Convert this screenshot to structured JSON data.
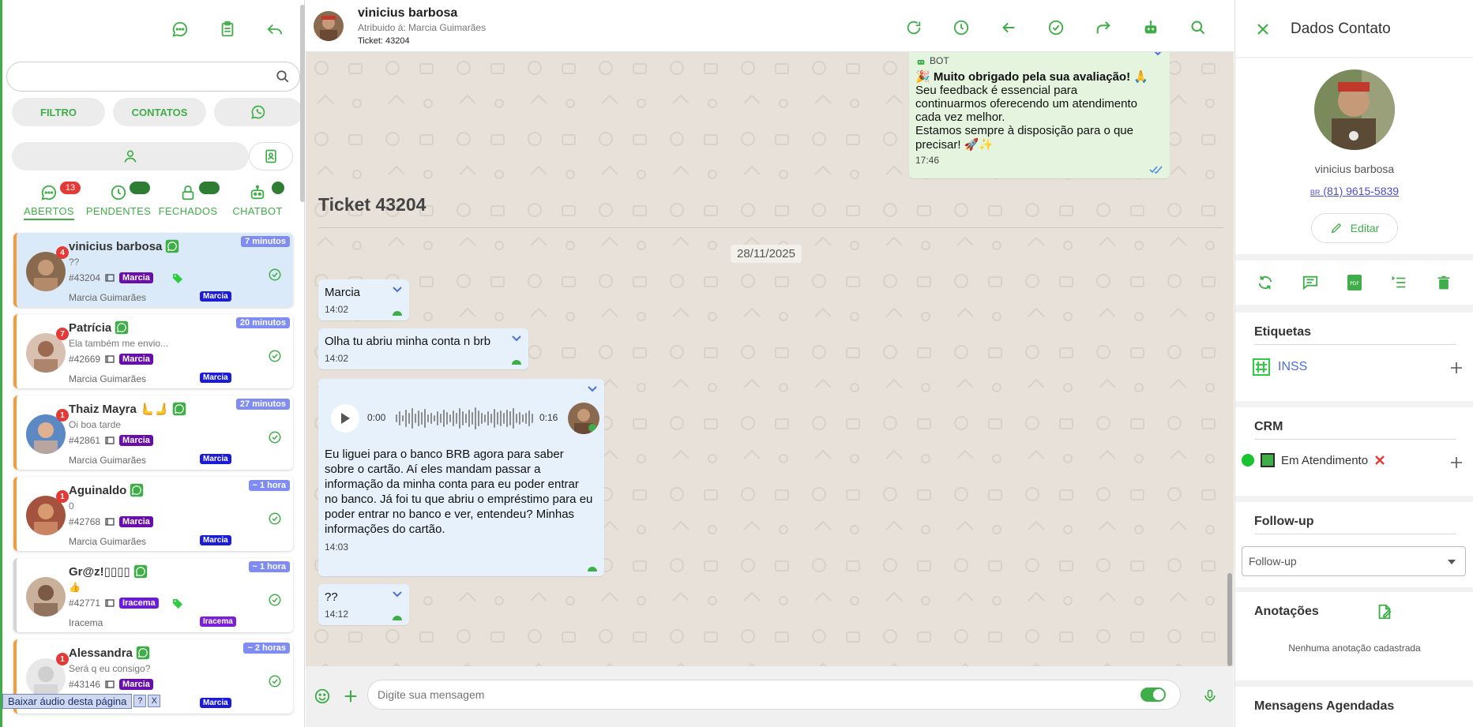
{
  "left": {
    "search": {
      "placeholder": "",
      "value": ""
    },
    "filters": [
      {
        "label": "FILTRO"
      },
      {
        "label": "CONTATOS"
      }
    ],
    "tabs": [
      {
        "label": "ABERTOS",
        "badge": "13",
        "icon": "chat-bubble-icon",
        "active": true
      },
      {
        "label": "PENDENTES",
        "badge": "0",
        "icon": "clock-icon"
      },
      {
        "label": "FECHADOS",
        "badge": "0",
        "icon": "lock-icon"
      },
      {
        "label": "CHATBOT",
        "badge": "0",
        "icon": "robot-icon"
      }
    ],
    "tickets": [
      {
        "name": "vinicius barbosa",
        "badge": "4",
        "message": "??",
        "id": "#43204",
        "tag": "Marcia",
        "user": "Marcia Guimarães",
        "user_tag": "Marcia",
        "time": "7 minutos",
        "selected": true,
        "label_icon": true
      },
      {
        "name": "Patrícia",
        "badge": "7",
        "message": "Ela também me envio...",
        "id": "#42669",
        "tag": "Marcia",
        "user": "Marcia Guimarães",
        "user_tag": "Marcia",
        "time": "20 minutos"
      },
      {
        "name": "Thaiz Mayra",
        "emoji": "🫷🫸",
        "badge": "1",
        "message": "Oi boa tarde",
        "id": "#42861",
        "tag": "Marcia",
        "user": "Marcia Guimarães",
        "user_tag": "Marcia",
        "time": "27 minutos"
      },
      {
        "name": "Aguinaldo",
        "badge": "1",
        "message": "0",
        "id": "#42768",
        "tag": "Marcia",
        "user": "Marcia Guimarães",
        "user_tag": "Marcia",
        "time": "~ 1 hora"
      },
      {
        "name": "Gr@z!▯▯▯▯",
        "badge": "",
        "message": "👍",
        "id": "#42771",
        "tag": "Iracema",
        "user": "Iracema",
        "user_tag": "Iracema",
        "time": "~ 1 hora",
        "label_icon": true,
        "gray": true
      },
      {
        "name": "Alessandra",
        "badge": "1",
        "message": "Será q eu consigo?",
        "id": "#43146",
        "tag": "Marcia",
        "user": "",
        "user_tag": "Marcia",
        "time": "~ 2 horas"
      }
    ],
    "audio_helper": {
      "label": "Baixar áudio desta página",
      "help": "?",
      "close": "X"
    }
  },
  "chat": {
    "header": {
      "name": "vinicius barbosa",
      "assigned": "Atribuido à: Marcia Guimarães",
      "ticket": "Ticket: 43204"
    },
    "bot_message": {
      "sender": "BOT",
      "lines": [
        "🎉 Muito obrigado pela sua avaliação! 🙏",
        "Seu feedback é essencial para",
        "continuarmos oferecendo um atendimento",
        "cada vez melhor.",
        "Estamos sempre à disposição para o que",
        "precisar! 🚀✨"
      ],
      "time": "17:46"
    },
    "ticket_title": "Ticket 43204",
    "date": "28/11/2025",
    "messages": [
      {
        "text": "Marcia",
        "time": "14:02"
      },
      {
        "text": "Olha tu abriu minha conta n brb",
        "time": "14:02"
      },
      {
        "audio_start": "0:00",
        "audio_end": "0:16",
        "text": "Eu liguei para o banco BRB agora para saber sobre o cartão. Aí eles mandam passar a informação da minha conta para eu poder entrar no banco. Já foi tu que abriu o empréstimo para eu poder entrar no banco e ver, entendeu? Minhas informações do cartão.",
        "time": "14:03"
      },
      {
        "text": "??",
        "time": "14:12"
      }
    ],
    "composer": {
      "placeholder": "Digite sua mensagem"
    }
  },
  "contact": {
    "title": "Dados Contato",
    "name": "vinicius barbosa",
    "phone": "🇧🇷 (81) 9615-5839",
    "phone_flag": "BR",
    "phone_number": "(81) 9615-5839",
    "edit_label": "Editar",
    "etiquetas": {
      "title": "Etiquetas",
      "items": [
        "INSS"
      ]
    },
    "crm": {
      "title": "CRM",
      "status": "Em Atendimento"
    },
    "followup": {
      "title": "Follow-up",
      "selected": "Follow-up"
    },
    "anotacoes": {
      "title": "Anotações",
      "empty": "Nenhuma anotação cadastrada"
    },
    "agendadas": {
      "title": "Mensagens Agendadas"
    }
  },
  "colors": {
    "accent": "#3fae49",
    "ticket_tag": "#6a0dad",
    "time_badge": "#7e8cf3",
    "badge_red": "#e53935"
  }
}
